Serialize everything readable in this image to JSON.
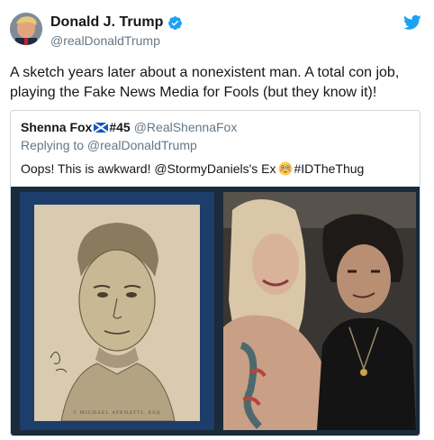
{
  "author": {
    "name": "Donald J. Trump",
    "handle": "@realDonaldTrump"
  },
  "tweet": {
    "text": "A sketch years later about a nonexistent man. A total con job, playing the Fake News Media for Fools (but they know it)!"
  },
  "quoted_tweet": {
    "name": "Shenna Fox",
    "name_suffix": "#45",
    "handle": "@RealShennaFox",
    "replying_to": "Replying to @realDonaldTrump",
    "text_before_emoji": "Oops! This is awkward! @StormyDaniels's Ex",
    "text_after_emoji": "#IDTheThug",
    "media": {
      "left_image": "composite-sketch",
      "right_image": "photo-of-two-people",
      "sketch_caption": "C MICHAEL AVENATTI, ESQ"
    }
  },
  "icons": {
    "verified": "verified-badge-icon",
    "brand": "twitter-bird-icon",
    "flag": "scotland-flag-icon",
    "emoji": "flushed-face-icon"
  },
  "colors": {
    "brand_blue": "#1da1f2",
    "text": "#14171a",
    "secondary": "#657786",
    "border": "#d3d9de"
  }
}
